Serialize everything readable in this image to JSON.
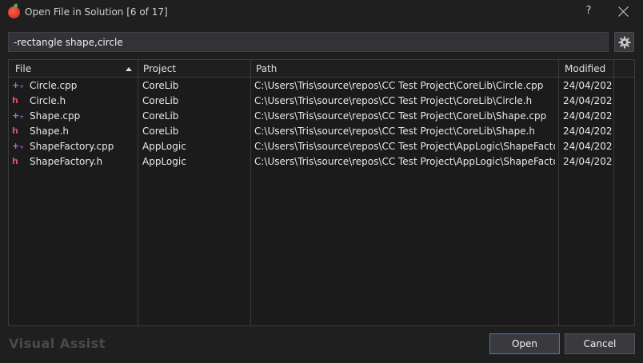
{
  "window": {
    "title": "Open File in Solution [6 of 17]",
    "help_label": "?"
  },
  "search": {
    "value": "-rectangle shape,circle"
  },
  "columns": [
    {
      "label": "File",
      "sorted": "ascending"
    },
    {
      "label": "Project"
    },
    {
      "label": "Path"
    },
    {
      "label": "Modified"
    }
  ],
  "rows": [
    {
      "icon": "cpp-file-icon",
      "type": "cpp",
      "file": "Circle.cpp",
      "project": "CoreLib",
      "path": "C:\\Users\\Tris\\source\\repos\\CC Test Project\\CoreLib\\Circle.cpp",
      "modified": "24/04/202..."
    },
    {
      "icon": "header-file-icon",
      "type": "h",
      "file": "Circle.h",
      "project": "CoreLib",
      "path": "C:\\Users\\Tris\\source\\repos\\CC Test Project\\CoreLib\\Circle.h",
      "modified": "24/04/202..."
    },
    {
      "icon": "cpp-file-icon",
      "type": "cpp",
      "file": "Shape.cpp",
      "project": "CoreLib",
      "path": "C:\\Users\\Tris\\source\\repos\\CC Test Project\\CoreLib\\Shape.cpp",
      "modified": "24/04/202..."
    },
    {
      "icon": "header-file-icon",
      "type": "h",
      "file": "Shape.h",
      "project": "CoreLib",
      "path": "C:\\Users\\Tris\\source\\repos\\CC Test Project\\CoreLib\\Shape.h",
      "modified": "24/04/202..."
    },
    {
      "icon": "cpp-file-icon",
      "type": "cpp",
      "file": "ShapeFactory.cpp",
      "project": "AppLogic",
      "path": "C:\\Users\\Tris\\source\\repos\\CC Test Project\\AppLogic\\ShapeFactory....",
      "modified": "24/04/202..."
    },
    {
      "icon": "header-file-icon",
      "type": "h",
      "file": "ShapeFactory.h",
      "project": "AppLogic",
      "path": "C:\\Users\\Tris\\source\\repos\\CC Test Project\\AppLogic\\ShapeFactory.h",
      "modified": "24/04/202..."
    }
  ],
  "footer": {
    "brand": "Visual Assist",
    "open_label": "Open",
    "cancel_label": "Cancel"
  },
  "colors": {
    "background": "#1f1f1f",
    "cpp_icon": "#b46bd6",
    "header_icon": "#e0505a",
    "primary_border": "#3f7fbf"
  }
}
